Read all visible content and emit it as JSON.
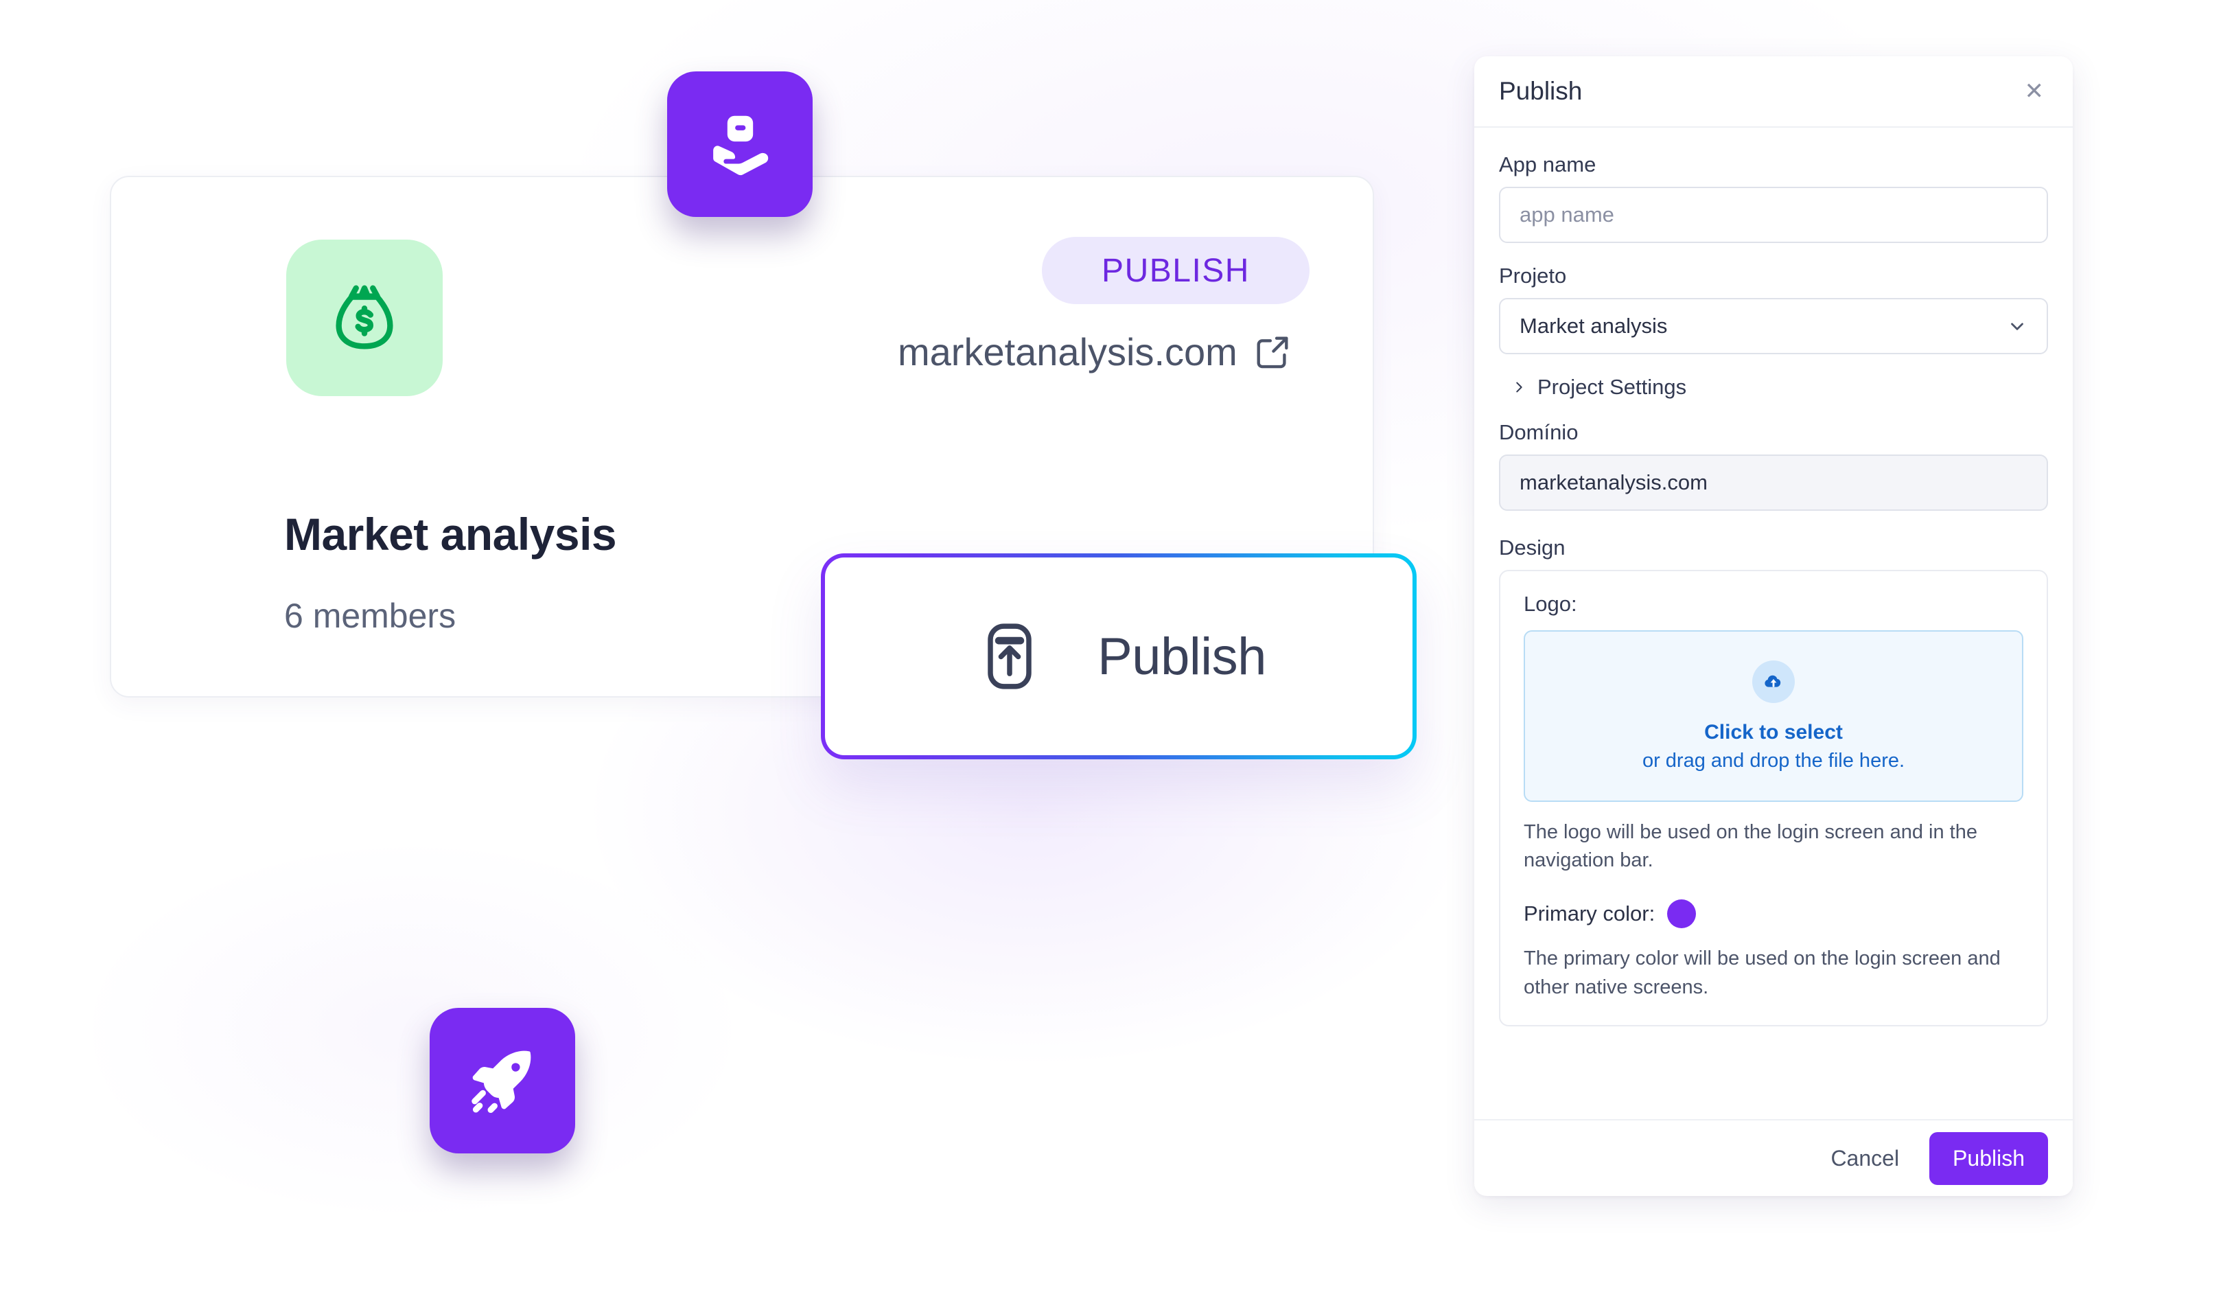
{
  "project_card": {
    "icon": "money-bag-icon",
    "title": "Market analysis",
    "members": "6 members",
    "status_badge": "PUBLISH",
    "site_url": "marketanalysis.com",
    "external_link_icon": "external-link-icon"
  },
  "big_publish_button": {
    "label": "Publish",
    "icon": "upload-box-icon",
    "gradient_start": "#7b2ff7",
    "gradient_end": "#06c9f5"
  },
  "floating_tiles": [
    {
      "name": "hand-holding-package-icon",
      "color": "#7a2bf2"
    },
    {
      "name": "rocket-icon",
      "color": "#7a2bf2"
    },
    {
      "name": "cloud-upload-icon",
      "color": "#7a2bf2"
    }
  ],
  "panel": {
    "title": "Publish",
    "close_icon": "close-icon",
    "app_name": {
      "label": "App name",
      "value": "",
      "placeholder": "app name"
    },
    "projeto": {
      "label": "Projeto",
      "value": "Market analysis",
      "chevron_icon": "chevron-down-icon"
    },
    "project_settings": {
      "label": "Project Settings",
      "chevron_icon": "chevron-right-icon"
    },
    "dominio": {
      "label": "Domínio",
      "value": "marketanalysis.com"
    },
    "design": {
      "label": "Design",
      "logo_label": "Logo:",
      "dropzone": {
        "icon": "cloud-upload-icon",
        "line1": "Click to select",
        "line2": "or drag and drop the file here."
      },
      "logo_help": "The logo will be used on the login screen and in the navigation bar.",
      "primary_color_label": "Primary color:",
      "primary_color_value": "#7a2bf2",
      "primary_color_help": "The primary color will be used on the login screen and other native screens."
    },
    "footer": {
      "cancel_label": "Cancel",
      "publish_label": "Publish"
    }
  }
}
